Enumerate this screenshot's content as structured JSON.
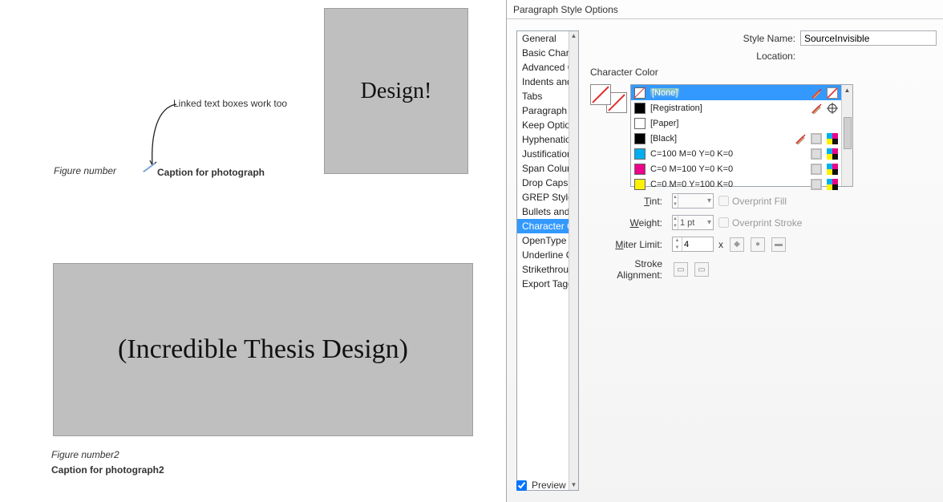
{
  "canvas": {
    "annotation": "Linked text boxes work too",
    "box1_text": "Design!",
    "fig1_num": "Figure number",
    "fig1_caption": "Caption for photograph",
    "box2_text": "(Incredible Thesis Design)",
    "fig2_num": "Figure number2",
    "fig2_caption": "Caption for photograph2"
  },
  "dialog": {
    "title": "Paragraph Style Options",
    "style_name_label": "Style Name:",
    "style_name_value": "SourceInvisible",
    "location_label": "Location:",
    "section": "Character Color",
    "side_items": [
      "General",
      "Basic Character Formats",
      "Advanced Character Formats",
      "Indents and Spacing",
      "Tabs",
      "Paragraph Rules",
      "Keep Options",
      "Hyphenation",
      "Justification",
      "Span Columns",
      "Drop Caps and Nested Styles",
      "GREP Style",
      "Bullets and Numbering",
      "Character Color",
      "OpenType Features",
      "Underline Options",
      "Strikethrough Options",
      "Export Tagging"
    ],
    "side_selected": "Character Color",
    "swatches": [
      {
        "name": "[None]",
        "color": "none",
        "selected": true,
        "icons": [
          "pencil-x",
          "none-diag"
        ]
      },
      {
        "name": "[Registration]",
        "color": "#000000",
        "icons": [
          "pencil-x",
          "registration"
        ]
      },
      {
        "name": "[Paper]",
        "color": "#ffffff",
        "icons": []
      },
      {
        "name": "[Black]",
        "color": "#000000",
        "icons": [
          "pencil-x",
          "process",
          "cmyk"
        ]
      },
      {
        "name": "C=100 M=0 Y=0 K=0",
        "color": "#00aeef",
        "icons": [
          "process",
          "cmyk"
        ]
      },
      {
        "name": "C=0 M=100 Y=0 K=0",
        "color": "#ec008c",
        "icons": [
          "process",
          "cmyk"
        ]
      },
      {
        "name": "C=0 M=0 Y=100 K=0",
        "color": "#fff200",
        "icons": [
          "process",
          "cmyk"
        ]
      }
    ],
    "fields": {
      "tint_label": "Tint:",
      "tint_value": "",
      "overprint_fill": "Overprint Fill",
      "weight_label": "Weight:",
      "weight_value": "1 pt",
      "overprint_stroke": "Overprint Stroke",
      "miter_label": "Miter Limit:",
      "miter_value": "4",
      "miter_x": "x",
      "stroke_align_label": "Stroke Alignment:"
    },
    "preview_label": "Preview"
  }
}
